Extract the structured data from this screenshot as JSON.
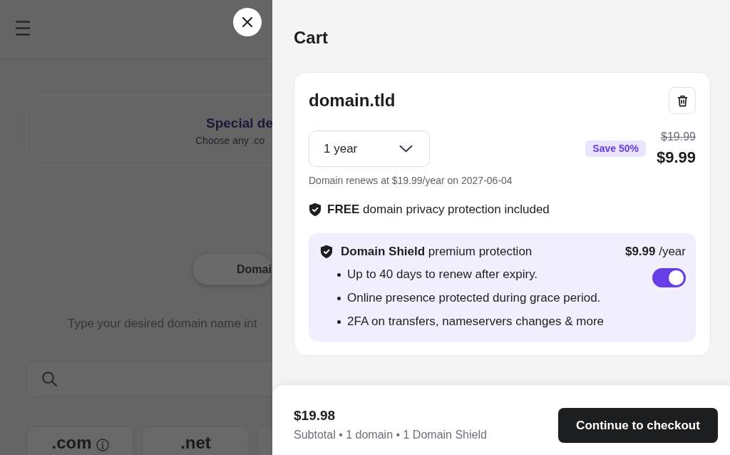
{
  "background_page": {
    "promo": {
      "title": "Special de",
      "subtitle": "Choose any .co"
    },
    "tabs": [
      {
        "label": "Domai",
        "selected": true
      }
    ],
    "instruction": "Type your desired domain name int",
    "tlds": [
      {
        "kind": "tld",
        "label": ".com",
        "info": true
      },
      {
        "kind": "tld",
        "label": ".net",
        "info": false
      },
      {
        "kind": "cut_off"
      }
    ]
  },
  "cart": {
    "title": "Cart",
    "items": [
      {
        "domain": "domain.tld",
        "period": "1 year",
        "discount": "Save 50%",
        "old_price": "$19.99",
        "price": "$9.99",
        "renewal_note": "Domain renews at $19.99/year on 2027-06-04",
        "privacy_note": "**FREE** domain privacy protection included",
        "addon": {
          "title": "**Domain Shield** premium protection",
          "price": "**$9.99** /year",
          "on": true,
          "features": [
            "Up to 40 days to renew after expiry.",
            "Online presence protected during grace period.",
            "2FA on transfers, nameservers changes & more"
          ]
        }
      }
    ]
  },
  "summary": {
    "total": "$19.98",
    "details": "Subtotal • 1 domain • 1 Domain Shield",
    "checkout_button": "Continue to checkout"
  }
}
